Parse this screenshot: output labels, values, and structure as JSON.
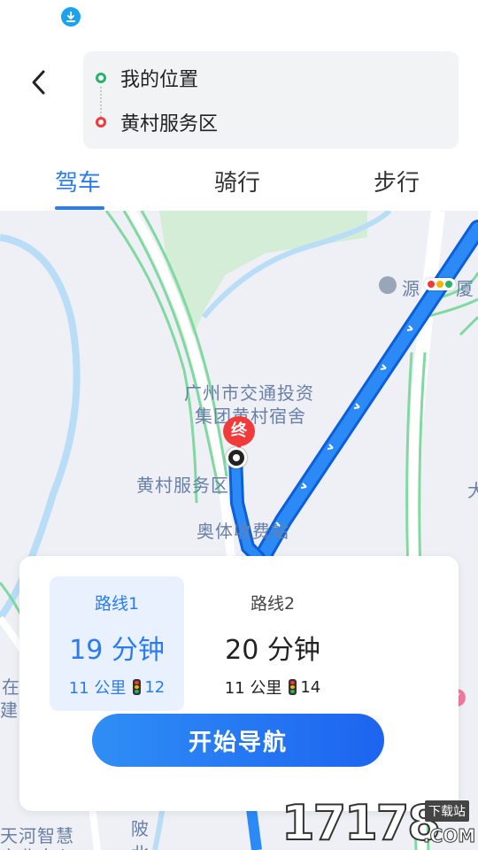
{
  "header": {
    "start_location": "我的位置",
    "end_location": "黄村服务区"
  },
  "tabs": [
    {
      "label": "驾车",
      "active": true
    },
    {
      "label": "骑行",
      "active": false
    },
    {
      "label": "步行",
      "active": false
    }
  ],
  "map": {
    "labels": {
      "poi_1_line1": "广州市交通投资",
      "poi_1_line2": "集团黄村宿舍",
      "service_area": "黄村服务区",
      "toll_station": "奥体收费站",
      "building_partial": "源",
      "building_partial_2": "厦",
      "right_edge": "大",
      "bottom_left": "天河智慧",
      "bottom_left_2": "产业中心",
      "bottom_mid": "陂",
      "bottom_mid_2": "北",
      "left_edge": "在",
      "left_edge_2": "建"
    },
    "end_marker": "终"
  },
  "routes": [
    {
      "name": "路线1",
      "time": "19 分钟",
      "distance": "11 公里",
      "lights": "12",
      "selected": true
    },
    {
      "name": "路线2",
      "time": "20 分钟",
      "distance": "11 公里",
      "lights": "14",
      "selected": false
    }
  ],
  "actions": {
    "start_navigation": "开始导航"
  },
  "watermark": {
    "number": "17178",
    "tag": "下载站",
    "domain": ".COM"
  },
  "colors": {
    "accent": "#2a7cf0",
    "route_blue": "#1677f0",
    "start_dot": "#27b36c",
    "end_dot": "#f23a3a"
  }
}
